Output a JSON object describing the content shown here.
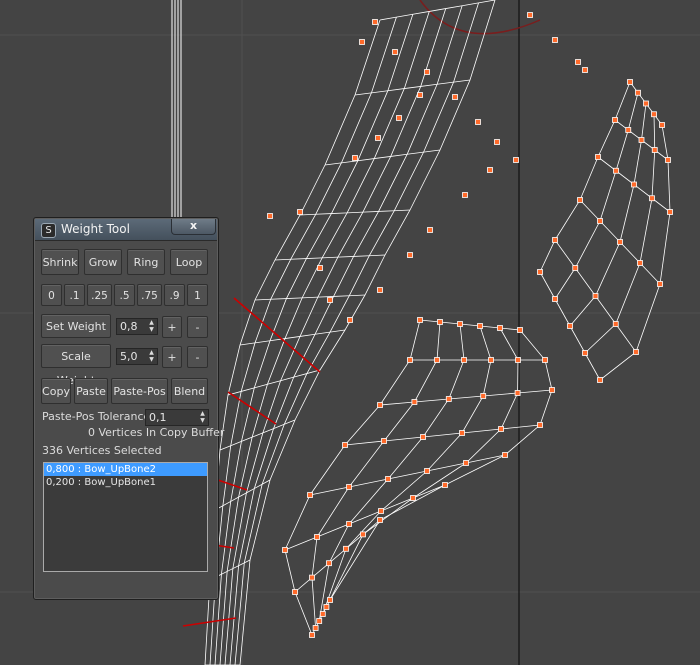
{
  "window": {
    "title": "Weight Tool",
    "close_label": "x"
  },
  "selection_buttons": [
    "Shrink",
    "Grow",
    "Ring",
    "Loop"
  ],
  "preset_weights": [
    "0",
    ".1",
    ".25",
    ".5",
    ".75",
    ".9",
    "1"
  ],
  "set_weight": {
    "label": "Set Weight",
    "value": "0,8",
    "plus": "+",
    "minus": "-"
  },
  "scale_weight": {
    "label": "Scale Weight",
    "value": "5,0",
    "plus": "+",
    "minus": "-"
  },
  "copy_buttons": [
    "Copy",
    "Paste",
    "Paste-Pos",
    "Blend"
  ],
  "paste_pos_tolerance": {
    "label": "Paste-Pos Tolerance",
    "value": "0,1"
  },
  "copy_buffer_status": "0 Vertices In Copy Buffer",
  "vertices_selected": "336 Vertices Selected",
  "bone_list": [
    {
      "text": "0,800 : Bow_UpBone2",
      "selected": true
    },
    {
      "text": "0,200 : Bow_UpBone1",
      "selected": false
    }
  ],
  "colors": {
    "viewport_bg": "#444444",
    "wire": "#ffffff",
    "vertex_fill": "#ff6a2a",
    "selected_edge": "#cc0000",
    "list_highlight": "#3e9bff"
  }
}
